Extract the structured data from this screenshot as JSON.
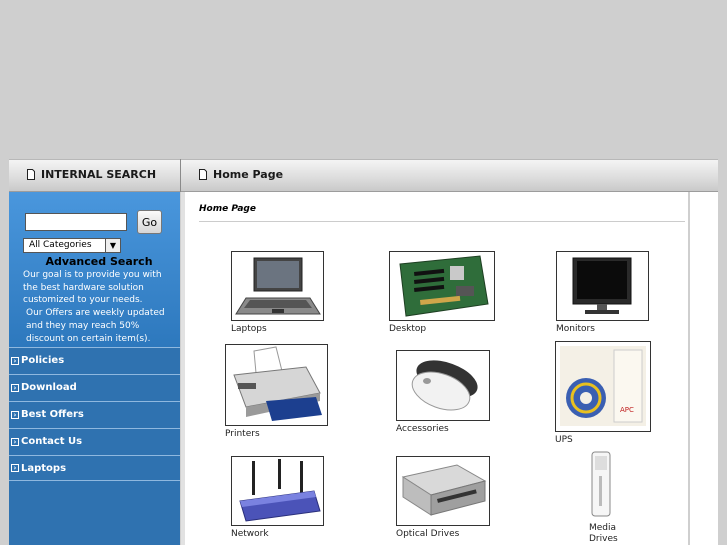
{
  "left_header": {
    "title": "INTERNAL SEARCH"
  },
  "right_header": {
    "title": "Home Page"
  },
  "search": {
    "input_value": "",
    "go_label": "Go",
    "category_selected": "All Categories",
    "advanced_label": "Advanced Search"
  },
  "sidebar_text": {
    "line1": "Our goal is to provide you with the best hardware solution customized to your needs.",
    "line2": "Our Offers are weekly updated and they may reach 50% discount on certain item(s)."
  },
  "nav": [
    {
      "label": "Policies"
    },
    {
      "label": "Download"
    },
    {
      "label": "Best Offers"
    },
    {
      "label": "Contact Us"
    },
    {
      "label": "Laptops"
    }
  ],
  "breadcrumb": "Home Page",
  "products": [
    {
      "label": "Laptops",
      "icon": "laptop-icon"
    },
    {
      "label": "Desktop",
      "icon": "motherboard-icon"
    },
    {
      "label": "Monitors",
      "icon": "monitor-icon"
    },
    {
      "label": "Printers",
      "icon": "printer-icon"
    },
    {
      "label": "Accessories",
      "icon": "mouse-icon"
    },
    {
      "label": "UPS",
      "icon": "ups-box-icon"
    },
    {
      "label": "Network",
      "icon": "router-icon"
    },
    {
      "label": "Optical Drives",
      "icon": "optical-drive-icon"
    },
    {
      "label": "Media Drives",
      "icon": "usb-drive-icon"
    }
  ]
}
